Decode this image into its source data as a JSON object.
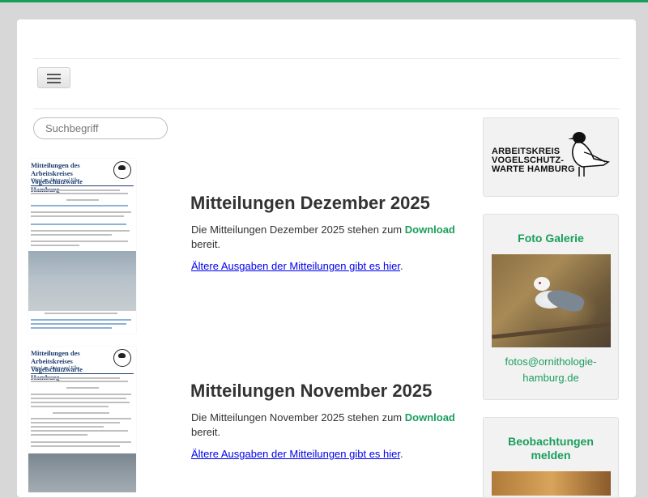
{
  "search": {
    "placeholder": "Suchbegriff"
  },
  "posts": [
    {
      "title": "Mitteilungen Dezember 2025",
      "text_before": "Die Mitteilungen Dezember 2025 stehen zum ",
      "download_label": "Download",
      "text_after": "bereit.",
      "archive_link": "Ältere Ausgaben der Mitteilungen gibt es hier",
      "archive_suffix": ".",
      "thumb": {
        "heading": "Mitteilungen des Arbeitskreises Vogelschutzwarte Hamburg",
        "subheading": "Vögel an Alster und Elbe"
      }
    },
    {
      "title": "Mitteilungen November 2025",
      "text_before": "Die Mitteilungen November 2025 stehen zum ",
      "download_label": "Download",
      "text_after": "bereit.",
      "archive_link": "Ältere Ausgaben der Mitteilungen gibt es hier",
      "archive_suffix": ".",
      "thumb": {
        "heading": "Mitteilungen des Arbeitskreises Vogelschutzwarte Hamburg",
        "subheading": "Vögel an Alster und Elbe"
      }
    }
  ],
  "sidebar": {
    "logo_lines": [
      "ARBEITSKREIS",
      "VOGELSCHUTZ-",
      "WARTE HAMBURG"
    ],
    "gallery": {
      "title": "Foto Galerie",
      "email_line1": "fotos@ornithologie-",
      "email_line2": "hamburg.de"
    },
    "report": {
      "title_line1": "Beobachtungen",
      "title_line2": "melden"
    }
  },
  "colors": {
    "accent": "#1a9e5c",
    "heading_navy": "#1d3d6e"
  }
}
